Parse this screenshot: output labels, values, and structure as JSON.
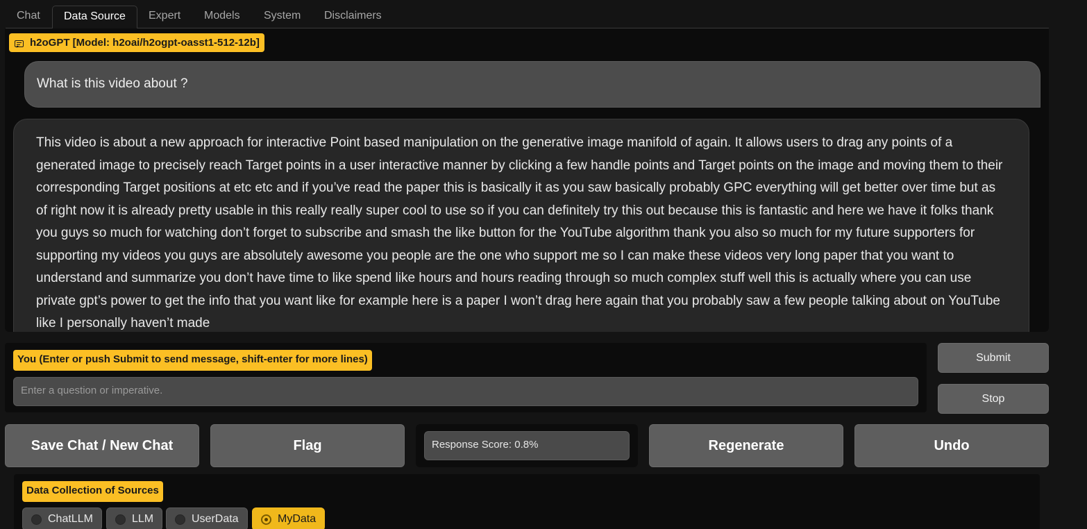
{
  "tabs": [
    "Chat",
    "Data Source",
    "Expert",
    "Models",
    "System",
    "Disclaimers"
  ],
  "active_tab": "Data Source",
  "chat": {
    "model_label": "h2oGPT [Model: h2oai/h2ogpt-oasst1-512-12b]",
    "user_message": "What is this video about ?",
    "bot_message": "This video is about a new approach for interactive Point based manipulation on the generative image manifold of again. It allows users to drag any points of a generated image to precisely reach Target points in a user interactive manner by clicking a few handle points and Target points on the image and moving them to their corresponding Target positions at etc etc and if you’ve read the paper this is basically it as you saw basically probably GPC everything will get better over time but as of right now it is already pretty usable in this really really super cool to use so if you can definitely try this out because this is fantastic and here we have it folks thank you guys so much for watching don’t forget to subscribe and smash the like button for the YouTube algorithm thank you also so much for my future supporters for supporting my videos you guys are absolutely awesome you people are the one who support me so I can make these videos very long paper that you want to understand and summarize you don’t have time to like spend like hours and hours reading through so much complex stuff well this is actually where you can use private gpt’s power to get the info that you want like for example here is a paper I won’t drag here again that you probably saw a few people talking about on YouTube like I personally haven’t made"
  },
  "input": {
    "label": "You (Enter or push Submit to send message, shift-enter for more lines)",
    "placeholder": "Enter a question or imperative.",
    "value": ""
  },
  "buttons": {
    "submit": "Submit",
    "stop": "Stop",
    "save_chat": "Save Chat / New Chat",
    "flag": "Flag",
    "regenerate": "Regenerate",
    "undo": "Undo"
  },
  "response_score": "Response Score: 0.8%",
  "data_collection": {
    "label": "Data Collection of Sources",
    "options": [
      "ChatLLM",
      "LLM",
      "UserData",
      "MyData"
    ],
    "selected": "MyData"
  },
  "colors": {
    "accent": "#fbbf24",
    "background": "#141414",
    "button": "#5e5e5e"
  }
}
